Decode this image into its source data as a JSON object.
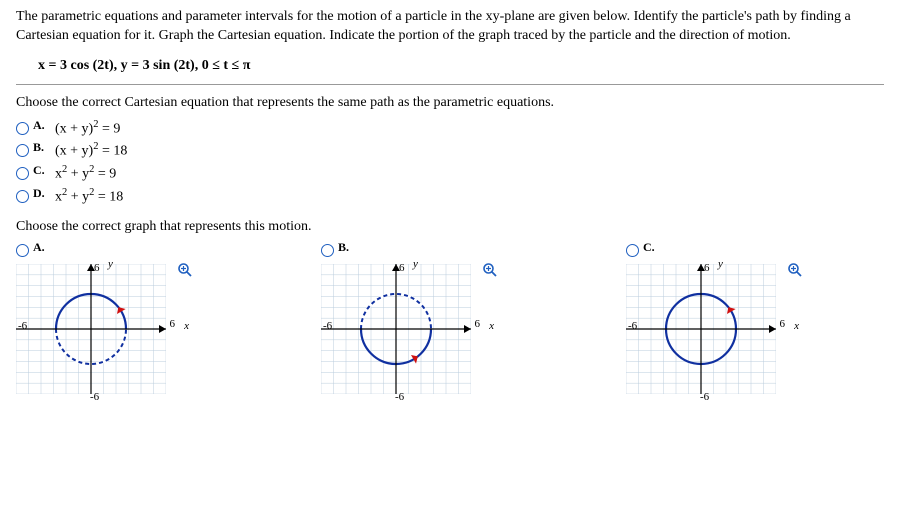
{
  "question": {
    "intro": "The parametric equations and parameter intervals for the motion of a particle in the xy-plane are given below. Identify the particle's path by finding a Cartesian equation for it. Graph the Cartesian equation. Indicate the portion of the graph traced by the particle and the direction of motion.",
    "equation": "x = 3 cos (2t),  y = 3 sin (2t),  0 ≤ t ≤ π"
  },
  "part1": {
    "prompt": "Choose the correct Cartesian equation that represents the same path as the parametric equations.",
    "choices": [
      {
        "letter": "A.",
        "html": "(x + y)<sup>2</sup> = 9"
      },
      {
        "letter": "B.",
        "html": "(x + y)<sup>2</sup> = 18"
      },
      {
        "letter": "C.",
        "html": "x<sup>2</sup> + y<sup>2</sup> = 9"
      },
      {
        "letter": "D.",
        "html": "x<sup>2</sup> + y<sup>2</sup> = 18"
      }
    ]
  },
  "part2": {
    "prompt": "Choose the correct graph that represents this motion.",
    "graphs": [
      {
        "letter": "A.",
        "arc": "lower",
        "solidHalf": "upper",
        "arrowAngle": 30
      },
      {
        "letter": "B.",
        "arc": "upper",
        "solidHalf": "lower",
        "arrowAngle": -60
      },
      {
        "letter": "C.",
        "arc": "full",
        "solidHalf": "none",
        "arrowAngle": 30
      }
    ],
    "axes": {
      "ylabel": "y",
      "xlabel": "x",
      "left": "-6",
      "right": "6",
      "top": "6",
      "bottom": "-6"
    }
  }
}
